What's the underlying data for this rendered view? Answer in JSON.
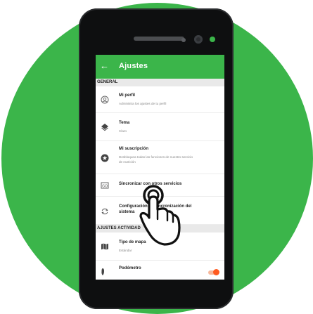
{
  "header": {
    "back_icon": "arrow-left-icon",
    "title": "Ajustes"
  },
  "sections": {
    "general": "GENERAL",
    "activity": "AJUSTES ACTIVIDAD"
  },
  "items": [
    {
      "icon": "user-icon",
      "title": "Mi perfil",
      "subtitle": "Administra los ajustes de tu perfil"
    },
    {
      "icon": "theme-icon",
      "title": "Tema",
      "subtitle": "Claro"
    },
    {
      "icon": "star-badge-icon",
      "title": "Mi suscripción",
      "subtitle1": "Desbloquea todas las funciones de nuestro servicio",
      "subtitle2": "de nutrición"
    },
    {
      "icon": "sync-services-icon",
      "title": "Sincronizar con otros servicios"
    },
    {
      "icon": "sync-icon",
      "title": "Configuración de sincronización del",
      "title2": "sistema"
    },
    {
      "icon": "map-icon",
      "title": "Tipo de mapa",
      "subtitle": "Estándar"
    },
    {
      "icon": "shoe-icon",
      "title": "Podómetro",
      "toggle_on": true
    }
  ],
  "colors": {
    "accent": "#3bb54a",
    "toggle": "#ff5a1f"
  }
}
